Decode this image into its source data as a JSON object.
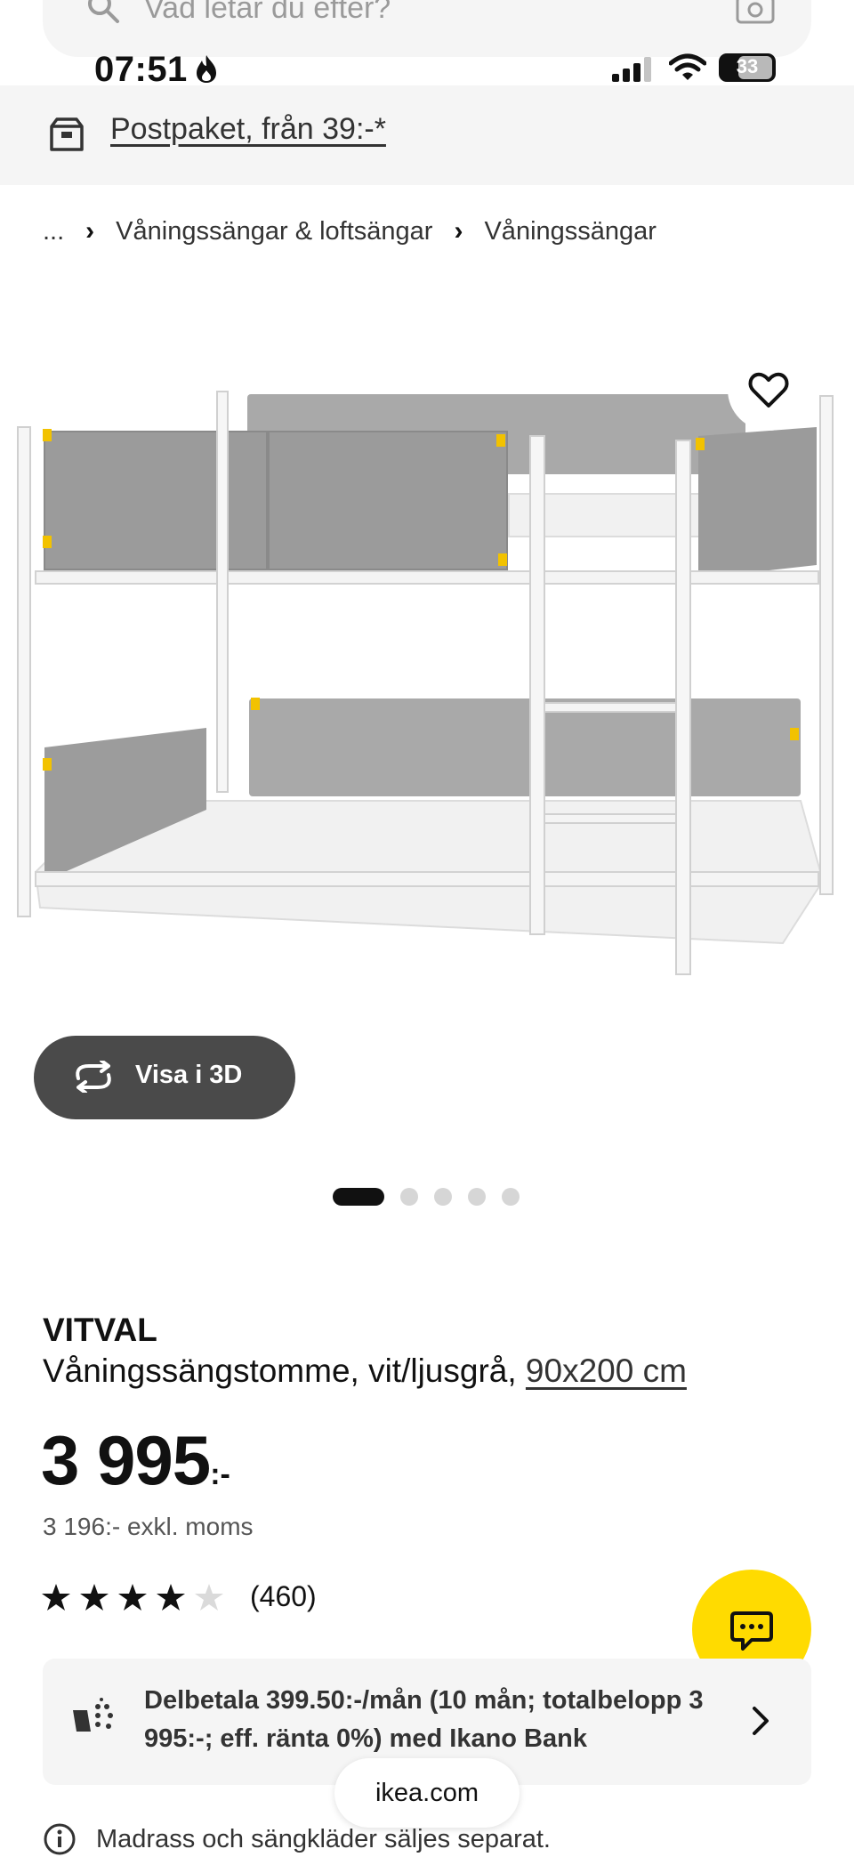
{
  "search": {
    "placeholder": "Vad letar du efter?",
    "icons": [
      "search-icon",
      "camera-icon"
    ]
  },
  "status_bar": {
    "time": "07:51",
    "battery": "33",
    "icons": [
      "flame-icon",
      "signal-icon",
      "wifi-icon",
      "battery-icon"
    ]
  },
  "promo": {
    "text": "Postpaket, från 39:-*",
    "icon": "parcel-icon"
  },
  "breadcrumb": {
    "items": [
      "...",
      "Våningssängar & loftsängar",
      "Våningssängar"
    ]
  },
  "gallery": {
    "view_3d_label": "Visa i 3D",
    "slide_count": 5,
    "active_slide": 1,
    "favorite_icon": "heart-icon"
  },
  "product": {
    "brand": "VITVAL",
    "description": "Våningssängstomme, vit/ljusgrå,",
    "size": "90x200 cm",
    "price": "3 995",
    "price_suffix": ":-",
    "price_excl_vat": "3 196:- exkl. moms",
    "rating": {
      "value": 4,
      "max": 5,
      "count": "(460)"
    }
  },
  "finance": {
    "text": "Delbetala 399.50:-/mån (10 mån; totalbelopp 3 995:-; eff. ränta 0%) med Ikano Bank"
  },
  "footer": {
    "url": "ikea.com",
    "note": "Madrass och sängkläder säljes separat."
  },
  "colors": {
    "accent_yellow": "#ffdb00",
    "frame_gray": "#8f8f8f",
    "dark_button": "#4a4a4a"
  }
}
